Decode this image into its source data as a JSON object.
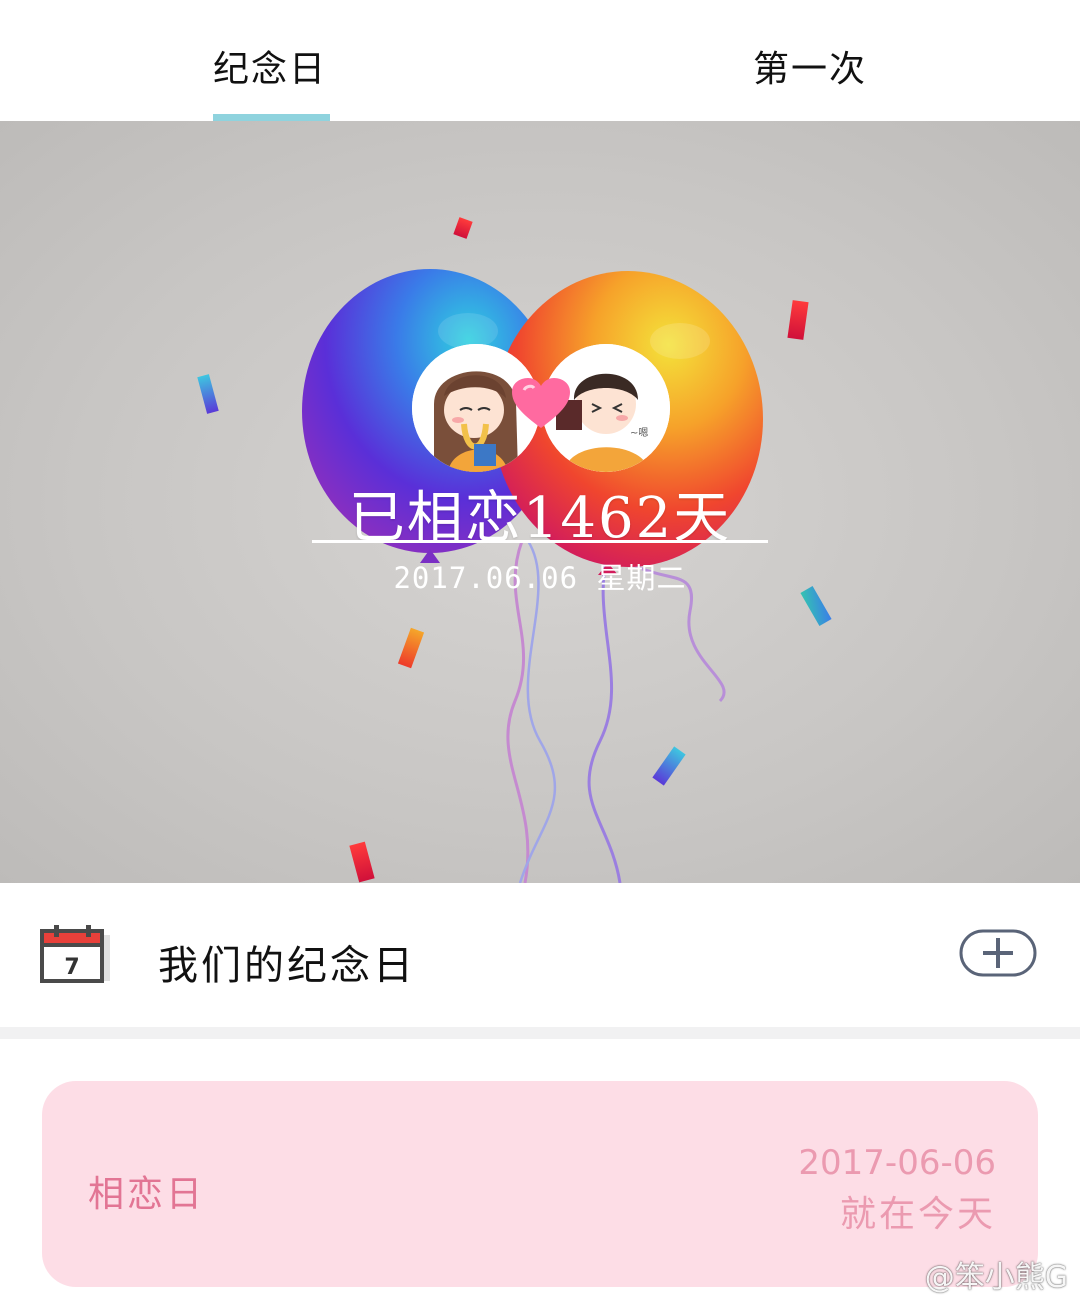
{
  "tabs": [
    {
      "label": "纪念日",
      "active": true
    },
    {
      "label": "第一次",
      "active": false
    }
  ],
  "accent_color": "#8fd3de",
  "hero": {
    "title": "已相恋1462天",
    "date": "2017.06.06 星期二",
    "background": "balloons-confetti-illustration",
    "avatars": [
      "girl-avatar",
      "boy-avatar"
    ],
    "heart_icon": "heart-icon"
  },
  "section": {
    "title": "我们的纪念日",
    "icon": "calendar-icon",
    "icon_day": "7",
    "add_icon": "plus-icon"
  },
  "anniversary_card": {
    "name": "相恋日",
    "date": "2017-06-06",
    "status": "就在今天",
    "background_color": "#fddde6",
    "text_color": "#e27594"
  },
  "watermark": "@笨小熊G"
}
